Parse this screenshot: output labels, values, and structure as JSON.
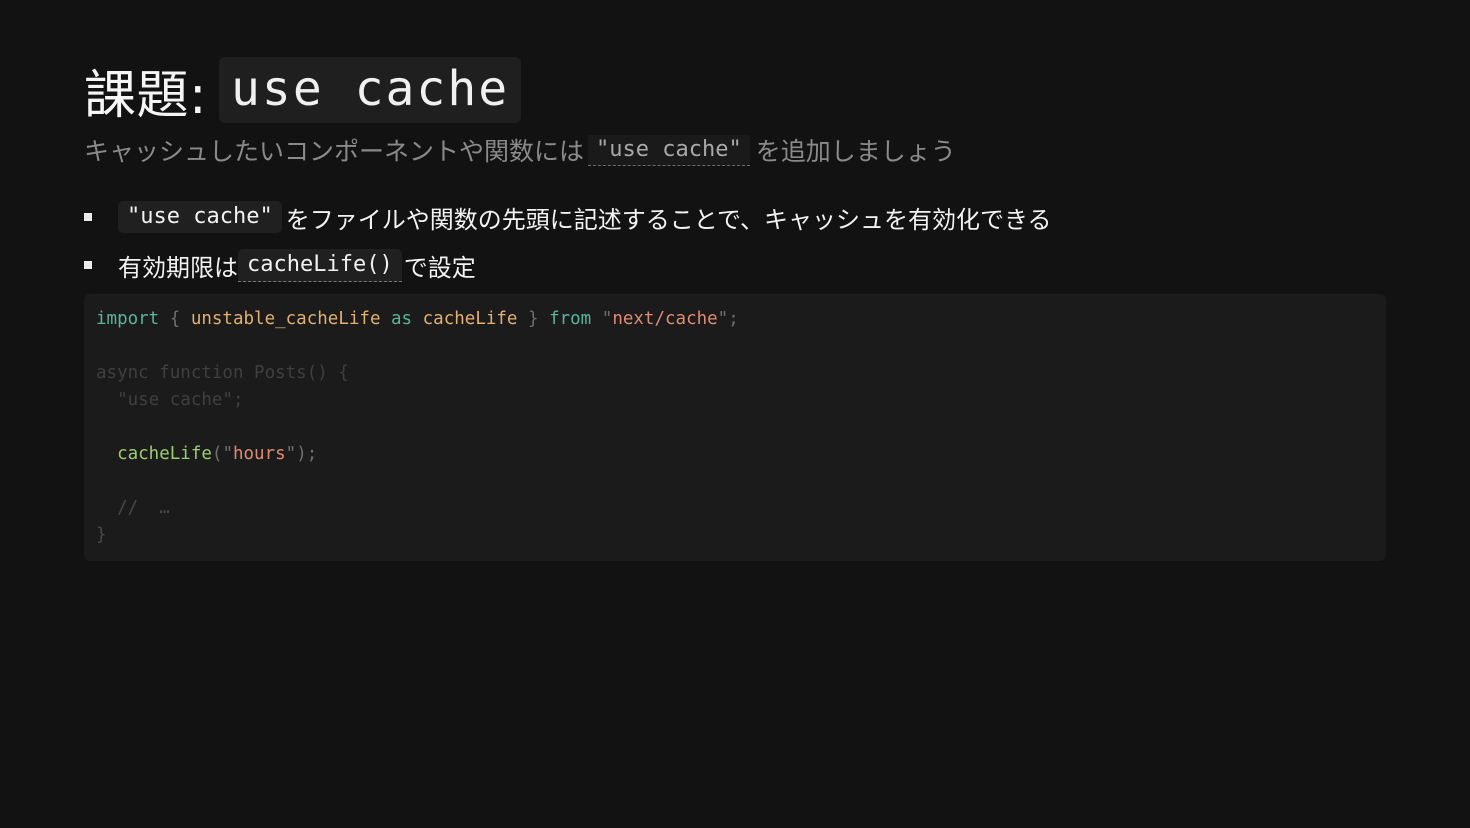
{
  "title": {
    "prefix": "課題:",
    "code": "use cache"
  },
  "subtitle": {
    "before": "キャッシュしたいコンポーネントや関数には",
    "code": "\"use cache\"",
    "after": "を追加しましょう"
  },
  "bullets": [
    {
      "code": "\"use cache\"",
      "text": "をファイルや関数の先頭に記述することで、キャッシュを有効化できる"
    },
    {
      "text_before": "有効期限は",
      "code": "cacheLife()",
      "text_after": "で設定"
    }
  ],
  "code": {
    "line1": {
      "kw_import": "import",
      "brace_open": " { ",
      "id_unstable": "unstable_cacheLife",
      "kw_as": " as ",
      "id_alias": "cacheLife",
      "brace_close": " } ",
      "kw_from": "from",
      "q1": " \"",
      "str_module": "next/cache",
      "q2": "\";"
    },
    "line3": "async function Posts() {",
    "line4": "  \"use cache\";",
    "line6": {
      "indent": "  ",
      "fn": "cacheLife",
      "p1": "(\"",
      "str": "hours",
      "p2": "\");"
    },
    "line8": "  //  …",
    "line9": "}"
  },
  "colors": {
    "background": "#121212",
    "code_bg": "#1b1b1b",
    "keyword": "#58b59a",
    "identifier": "#e3b070",
    "string": "#e08a74",
    "function": "#9ccd6f"
  }
}
